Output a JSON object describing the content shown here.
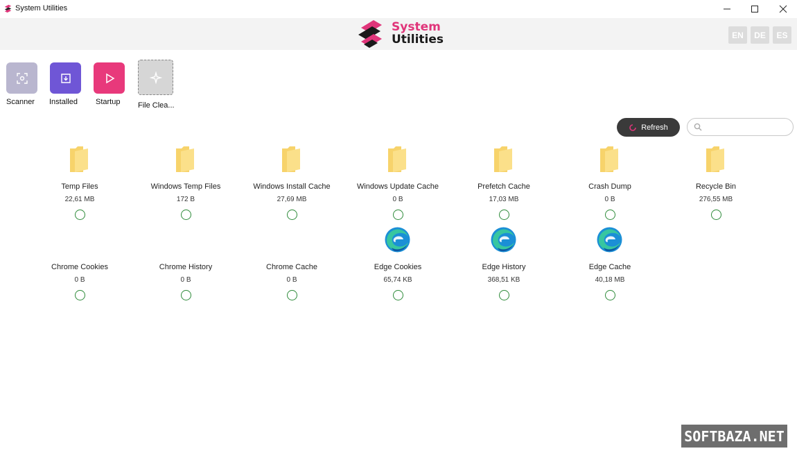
{
  "window": {
    "title": "System Utilities"
  },
  "brand": {
    "line1": "System",
    "line2": "Utilities",
    "accent": "#e0357a"
  },
  "languages": [
    "EN",
    "DE",
    "ES"
  ],
  "tools": [
    {
      "label": "Scanner",
      "icon": "scanner-icon",
      "color": "#b9b6cf"
    },
    {
      "label": "Installed",
      "icon": "installed-icon",
      "color": "#6f56d6"
    },
    {
      "label": "Startup",
      "icon": "play-icon",
      "color": "#e8397b"
    },
    {
      "label": "File Clea...",
      "icon": "sparkle-icon",
      "color": "#d6d6d6"
    }
  ],
  "toolbar": {
    "refresh_label": "Refresh",
    "search_placeholder": ""
  },
  "items": [
    {
      "name": "Temp Files",
      "size": "22,61 MB",
      "icon": "folder-icon"
    },
    {
      "name": "Windows Temp Files",
      "size": "172 B",
      "icon": "folder-icon"
    },
    {
      "name": "Windows Install Cache",
      "size": "27,69 MB",
      "icon": "folder-icon"
    },
    {
      "name": "Windows Update Cache",
      "size": "0 B",
      "icon": "folder-icon"
    },
    {
      "name": "Prefetch Cache",
      "size": "17,03 MB",
      "icon": "folder-icon"
    },
    {
      "name": "Crash Dump",
      "size": "0 B",
      "icon": "folder-icon"
    },
    {
      "name": "Recycle Bin",
      "size": "276,55 MB",
      "icon": "folder-icon"
    },
    {
      "name": "Chrome Cookies",
      "size": "0 B",
      "icon": ""
    },
    {
      "name": "Chrome History",
      "size": "0 B",
      "icon": ""
    },
    {
      "name": "Chrome Cache",
      "size": "0 B",
      "icon": ""
    },
    {
      "name": "Edge Cookies",
      "size": "65,74 KB",
      "icon": "edge-icon"
    },
    {
      "name": "Edge History",
      "size": "368,51 KB",
      "icon": "edge-icon"
    },
    {
      "name": "Edge Cache",
      "size": "40,18 MB",
      "icon": "edge-icon"
    }
  ],
  "watermark": "SOFTBAZA.NET"
}
